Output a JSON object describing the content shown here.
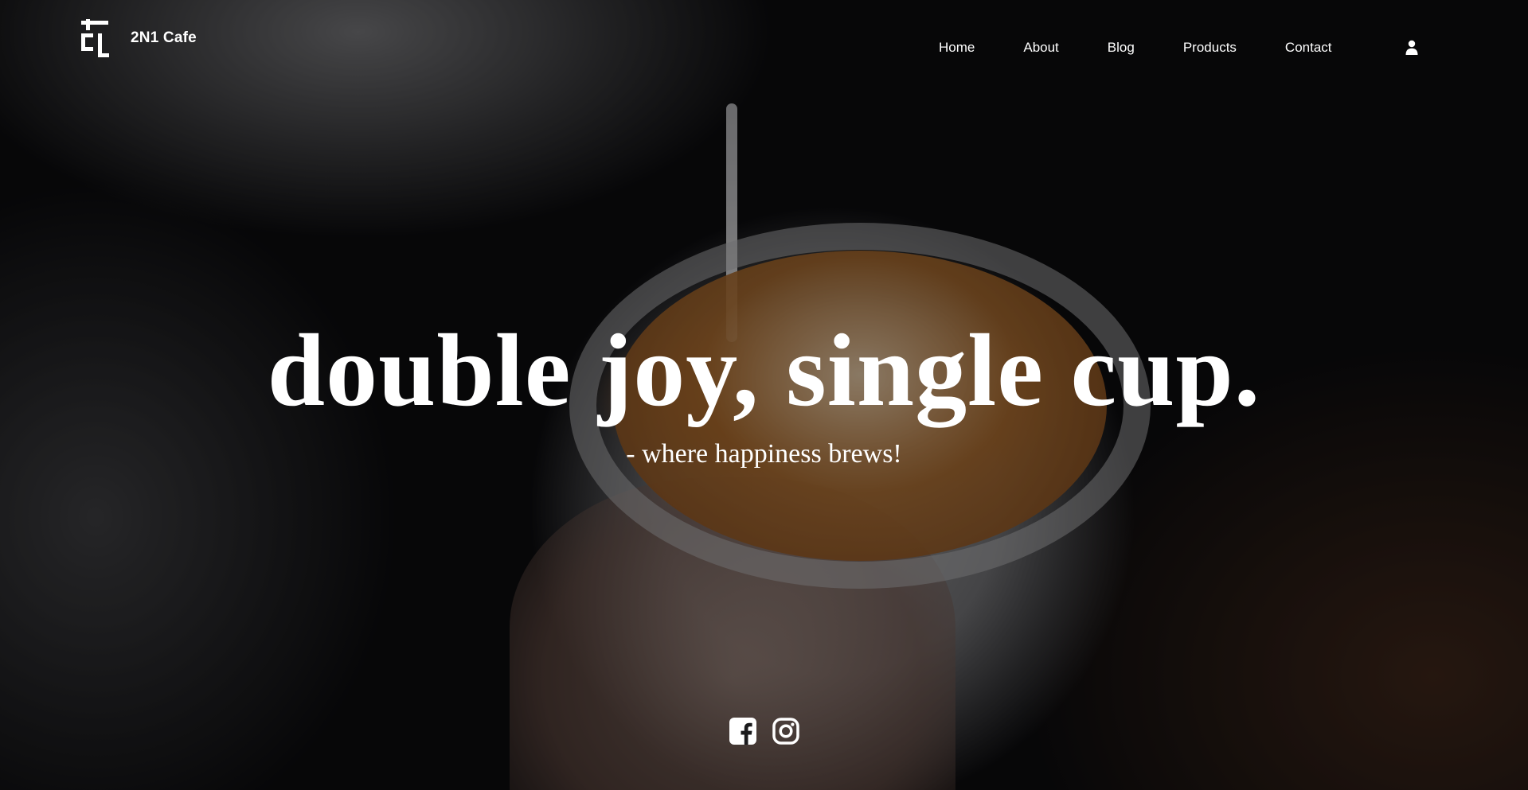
{
  "brand": {
    "name": "2N1 Cafe",
    "logo_icon": "2n1-logo-mark"
  },
  "nav": {
    "items": [
      {
        "label": "Home"
      },
      {
        "label": "About"
      },
      {
        "label": "Blog"
      },
      {
        "label": "Products"
      },
      {
        "label": "Contact"
      }
    ],
    "account_icon": "user-icon"
  },
  "hero": {
    "headline": "double joy, single cup.",
    "tagline": "- where happiness brews!",
    "background": "latte-art-pour-photo"
  },
  "social": {
    "facebook_icon": "facebook-icon",
    "instagram_icon": "instagram-icon"
  },
  "colors": {
    "text": "#ffffff",
    "background": "#0b0b0d",
    "coffee": "#a0642a"
  }
}
